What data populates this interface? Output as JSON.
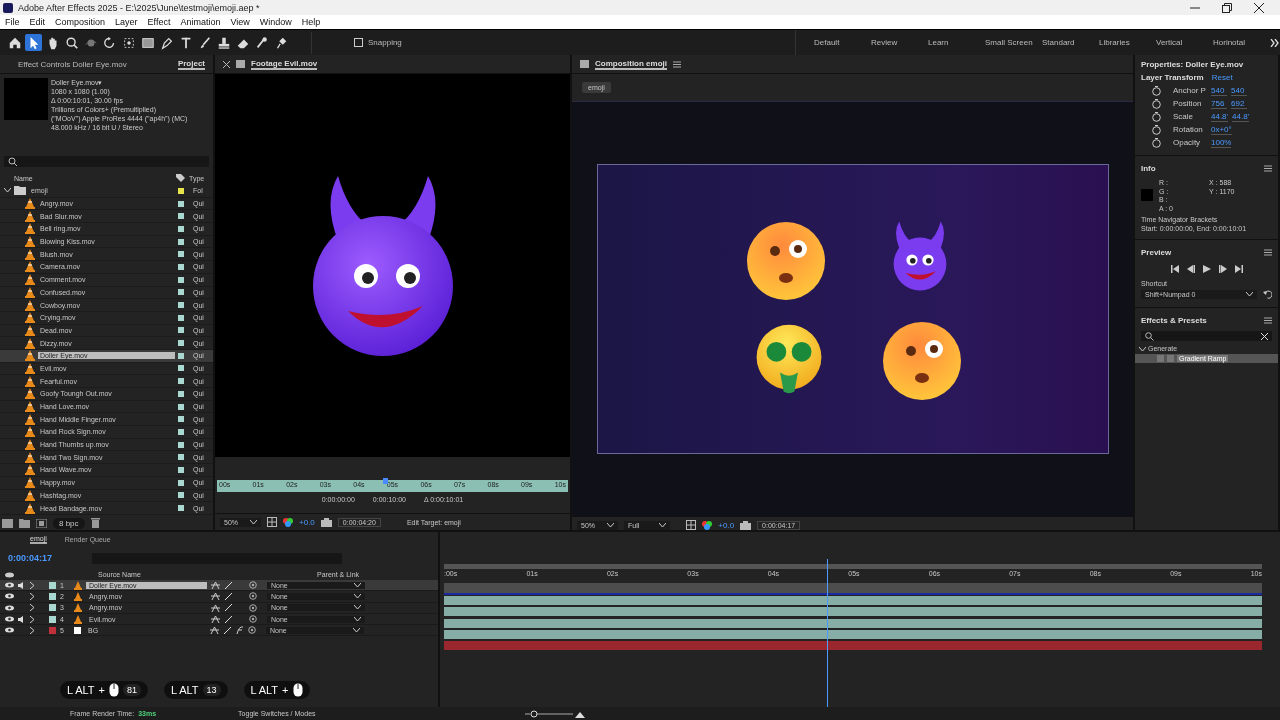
{
  "window": {
    "title": "Adobe After Effects 2025 - E:\\2025\\June\\testmoji\\emoji.aep *"
  },
  "menu": [
    "File",
    "Edit",
    "Composition",
    "Layer",
    "Effect",
    "Animation",
    "View",
    "Window",
    "Help"
  ],
  "toolbar": {
    "tools": [
      {
        "kind": "home",
        "selected": false
      },
      {
        "kind": "select",
        "selected": true
      },
      {
        "kind": "hand",
        "selected": false
      },
      {
        "kind": "zoom",
        "selected": false
      },
      {
        "kind": "orbit",
        "selected": false
      },
      {
        "kind": "rotate",
        "selected": false
      },
      {
        "kind": "anchor",
        "selected": false
      },
      {
        "kind": "rect",
        "selected": false
      },
      {
        "kind": "pen",
        "selected": false
      },
      {
        "kind": "text",
        "selected": false
      },
      {
        "kind": "brush",
        "selected": false
      },
      {
        "kind": "stamp",
        "selected": false
      },
      {
        "kind": "eraser",
        "selected": false
      },
      {
        "kind": "roto",
        "selected": false
      },
      {
        "kind": "pin",
        "selected": false
      }
    ],
    "snapping": {
      "label": "Snapping",
      "checked": false
    },
    "workspaces": [
      "Default",
      "Review",
      "Learn",
      "Small Screen",
      "Standard",
      "Libraries",
      "Vertical",
      "Horinotal"
    ]
  },
  "project": {
    "tabs": [
      {
        "label": "Effect Controls Doller Eye.mov",
        "selected": false
      },
      {
        "label": "Project",
        "selected": true
      }
    ],
    "info": [
      "Doller Eye.mov▾",
      "1080 x 1080 (1.00)",
      "Δ 0:00:10:01, 30.00 fps",
      "Trillions of Colors+ (Premultiplied)",
      "(\"MOoV\") Apple ProRes 4444 (\"ap4h\") (MC)",
      "48.000 kHz / 16 bit U / Stereo"
    ],
    "columns": [
      "Name",
      "Type"
    ],
    "folder": {
      "name": "emoji",
      "type": "Fol",
      "expanded": true,
      "children": [
        {
          "name": "Angry.mov",
          "type": "Qui",
          "selected": false
        },
        {
          "name": "Bad Slur.mov",
          "type": "Qui",
          "selected": false
        },
        {
          "name": "Bell ring.mov",
          "type": "Qui",
          "selected": false
        },
        {
          "name": "Blowing Kiss.mov",
          "type": "Qui",
          "selected": false
        },
        {
          "name": "Blush.mov",
          "type": "Qui",
          "selected": false
        },
        {
          "name": "Camera.mov",
          "type": "Qui",
          "selected": false
        },
        {
          "name": "Comment.mov",
          "type": "Qui",
          "selected": false
        },
        {
          "name": "Confused.mov",
          "type": "Qui",
          "selected": false
        },
        {
          "name": "Cowboy.mov",
          "type": "Qui",
          "selected": false
        },
        {
          "name": "Crying.mov",
          "type": "Qui",
          "selected": false
        },
        {
          "name": "Dead.mov",
          "type": "Qui",
          "selected": false
        },
        {
          "name": "Dizzy.mov",
          "type": "Qui",
          "selected": false
        },
        {
          "name": "Doller Eye.mov",
          "type": "Qui",
          "selected": true
        },
        {
          "name": "Evil.mov",
          "type": "Qui",
          "selected": false
        },
        {
          "name": "Fearful.mov",
          "type": "Qui",
          "selected": false
        },
        {
          "name": "Goofy Toungh Out.mov",
          "type": "Qui",
          "selected": false
        },
        {
          "name": "Hand Love.mov",
          "type": "Qui",
          "selected": false
        },
        {
          "name": "Hand Middle Finger.mov",
          "type": "Qui",
          "selected": false
        },
        {
          "name": "Hand Rock Sign.mov",
          "type": "Qui",
          "selected": false
        },
        {
          "name": "Hand Thumbs up.mov",
          "type": "Qui",
          "selected": false
        },
        {
          "name": "Hand Two Sign.mov",
          "type": "Qui",
          "selected": false
        },
        {
          "name": "Hand Wave.mov",
          "type": "Qui",
          "selected": false
        },
        {
          "name": "Happy.mov",
          "type": "Qui",
          "selected": false
        },
        {
          "name": "Hashtag.mov",
          "type": "Qui",
          "selected": false
        },
        {
          "name": "Head Bandage.mov",
          "type": "Qui",
          "selected": false
        }
      ]
    },
    "bpc": "8 bpc"
  },
  "footage": {
    "tab": "Footage Evil.mov",
    "ruler": [
      "00s",
      "01s",
      "02s",
      "03s",
      "04s",
      "05s",
      "06s",
      "07s",
      "08s",
      "09s",
      "10s"
    ],
    "playhead": {
      "level": 0.48
    },
    "in": "0:00:00:00",
    "out": "0:00:10:00",
    "duration": "Δ 0:00:10:01",
    "zoom": "50%",
    "exposure": "+0.0",
    "time": "0:00:04:20",
    "edit_target": "Edit Target: emoji"
  },
  "composition": {
    "tab": "Composition emoji",
    "crumb": "emoji",
    "zoom": "50%",
    "resolution": "Full",
    "exposure": "+0.0",
    "time": "0:00:04:17"
  },
  "properties": {
    "title": "Properties: Doller Eye.mov",
    "section": "Layer Transform",
    "reset": "Reset",
    "props": [
      {
        "name": "Anchor P",
        "values": [
          "540",
          "540"
        ]
      },
      {
        "name": "Position",
        "values": [
          "756",
          "692"
        ]
      },
      {
        "name": "Scale",
        "values": [
          "44.8'",
          "44.8'"
        ]
      },
      {
        "name": "Rotation",
        "values": [
          "0x+0°"
        ]
      },
      {
        "name": "Opacity",
        "values": [
          "100%"
        ]
      }
    ]
  },
  "info": {
    "title": "Info",
    "channels": [
      "R :",
      "G :",
      "B :",
      "A : 0"
    ],
    "coords": [
      "X : 588",
      "Y : 1170"
    ],
    "navigator": "Time Navigator Brackets",
    "range": "Start: 0:00:00:00, End: 0:00:10:01"
  },
  "preview": {
    "title": "Preview",
    "shortcut_label": "Shortcut",
    "shortcut": "Shift+Numpad 0"
  },
  "effects": {
    "title": "Effects & Presets",
    "category": {
      "name": "Generate",
      "expanded": true,
      "children": [
        {
          "name": "Gradient Ramp",
          "selected": true
        }
      ]
    }
  },
  "timeline": {
    "tabs": [
      {
        "label": "emoji",
        "selected": true
      },
      {
        "label": "Render Queue",
        "selected": false
      }
    ],
    "time": "0:00:04:17",
    "columns": [
      "Source Name",
      "Parent & Link"
    ],
    "ruler": [
      ":00s",
      "01s",
      "02s",
      "03s",
      "04s",
      "05s",
      "06s",
      "07s",
      "08s",
      "09s",
      "10s"
    ],
    "playhead": {
      "level": 0.468
    },
    "layers": [
      {
        "num": "1",
        "name": "Doller Eye.mov",
        "kind": "footage",
        "color": "#a8d8d0",
        "audio": true,
        "selected": true,
        "fx": false,
        "parent": "None"
      },
      {
        "num": "2",
        "name": "Angry.mov",
        "kind": "footage",
        "color": "#a8d8d0",
        "audio": false,
        "selected": false,
        "fx": false,
        "parent": "None"
      },
      {
        "num": "3",
        "name": "Angry.mov",
        "kind": "footage",
        "color": "#a8d8d0",
        "audio": false,
        "selected": false,
        "fx": false,
        "parent": "None"
      },
      {
        "num": "4",
        "name": "Evil.mov",
        "kind": "footage",
        "color": "#a8d8d0",
        "audio": true,
        "selected": false,
        "fx": false,
        "parent": "None"
      },
      {
        "num": "5",
        "name": "BG",
        "kind": "solid",
        "color": "#c0303a",
        "audio": false,
        "selected": false,
        "fx": true,
        "parent": "None"
      }
    ]
  },
  "status": {
    "label": "Frame Render Time:",
    "value": "33ms",
    "toggle": "Toggle Switches / Modes"
  },
  "keystrokes": [
    {
      "keys": [
        "L ALT",
        "+"
      ],
      "mouse": true,
      "count": "81"
    },
    {
      "keys": [
        "L ALT"
      ],
      "mouse": false,
      "count": "13"
    },
    {
      "keys": [
        "L ALT",
        "+"
      ],
      "mouse": true
    }
  ]
}
